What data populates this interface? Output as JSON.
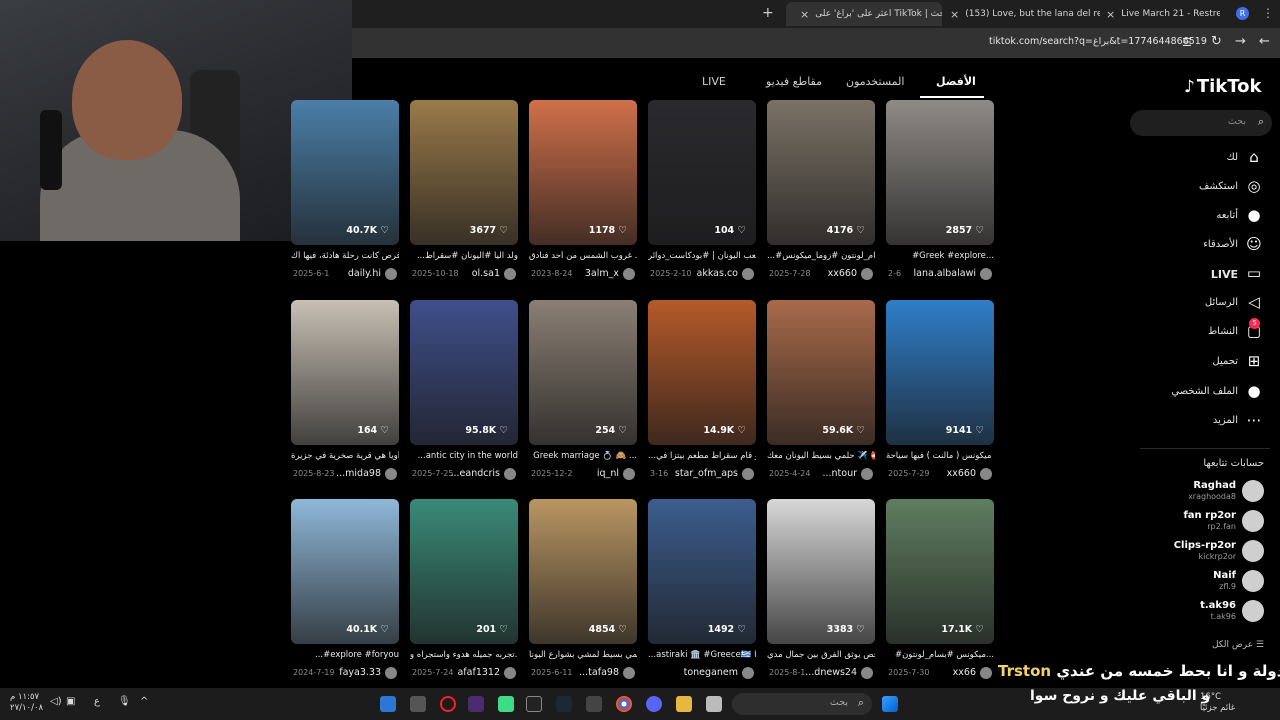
{
  "browser": {
    "tabs": [
      {
        "label": "Live March 21 - Restream"
      },
      {
        "label": "(153) Love, but the lana del rey"
      },
      {
        "label": "اعثر على 'براغ' على TikTok | بحث"
      }
    ],
    "url": "tiktok.com/search?q=براغ&t=1774644866519"
  },
  "header": {
    "categories": [
      "الأفضل",
      "المستخدمون",
      "مقاطع فيديو",
      "LIVE"
    ]
  },
  "sidebar": {
    "logo": "TikTok",
    "search_placeholder": "بحث",
    "nav": [
      {
        "label": "لك",
        "icon": "home-icon"
      },
      {
        "label": "استكشف",
        "icon": "compass-icon"
      },
      {
        "label": "أتابعه",
        "icon": "following-icon"
      },
      {
        "label": "الأصدقاء",
        "icon": "friends-icon"
      },
      {
        "label": "LIVE",
        "icon": "live-icon"
      },
      {
        "label": "الرسائل",
        "icon": "messages-icon"
      },
      {
        "label": "النشاط",
        "icon": "activity-icon",
        "badge": "5"
      },
      {
        "label": "تحميل",
        "icon": "upload-icon"
      },
      {
        "label": "الملف الشخصي",
        "icon": "profile-icon"
      },
      {
        "label": "المزيد",
        "icon": "more-icon"
      }
    ],
    "following_title": "حسابات تتابعها",
    "accounts": [
      {
        "name": "Raghad",
        "handle": "xraghooda8"
      },
      {
        "name": "fan rp2or",
        "handle": "rp2.fan"
      },
      {
        "name": "Clips-rp2or",
        "handle": "kickrp2or"
      },
      {
        "name": "Naif",
        "handle": "zfl.9"
      },
      {
        "name": "t.ak96",
        "handle": "t.ak96"
      }
    ],
    "see_all": "عرض الكل"
  },
  "videos": [
    {
      "likes": "2857",
      "caption": "#Greek #explore...",
      "date": "2-6",
      "user": "lana.albalawi",
      "color": "#8e8a86"
    },
    {
      "likes": "4176",
      "caption": "...#بسام_لونتون #زوما_ميكونس",
      "date": "2025-7-28",
      "user": "xx660",
      "color": "#7b7266"
    },
    {
      "likes": "104",
      "caption": "شعب اليونان | #بودكاست_دوائر",
      "date": "2025-2-10",
      "user": "akkas.co",
      "color": "#2a2a2e"
    },
    {
      "likes": "1178",
      "caption": "غروب الشمس من أحد فنادق ...",
      "date": "2023-8-24",
      "user": "3alm_x",
      "color": "#d0704a"
    },
    {
      "likes": "3677",
      "caption": "...ولد اليا #اليونان #سقراط",
      "date": "2025-10-18",
      "user": "ol.sa1",
      "color": "#9a7a4a"
    },
    {
      "likes": "40.7K",
      "caption": "فرص كانت رحلة هادئة، فيها أك...",
      "date": "2025-6-1",
      "user": "daily.hi",
      "color": "#4a7fa8"
    },
    {
      "likes": "9141",
      "caption": "ميكونس ( مالنت ) فيها سياحة ...",
      "date": "2025-7-29",
      "user": "xx660",
      "color": "#2f7ec9"
    },
    {
      "likes": "59.6K",
      "caption": "حلمي بسيط اليونان معك ✈️ 📛",
      "date": "2025-4-24",
      "user": "...ntour",
      "color": "#a86a4a"
    },
    {
      "likes": "14.9K",
      "caption": "...ماذا لو قام سقراط مطعم بيتزا في",
      "date": "3-16",
      "user": "star_ofm_aps",
      "color": "#b55a2a"
    },
    {
      "likes": "254",
      "caption": "Greek marriage 💍 🙈 ...",
      "date": "2025-12-2",
      "user": "iq_nl",
      "color": "#8b7f74"
    },
    {
      "likes": "95.8K",
      "caption": "...antic city in the world",
      "date": "2025-7-25",
      "user": "...eandcris",
      "color": "#3f4f8a"
    },
    {
      "likes": "164",
      "caption": "أويا هي قرية صخرية في جزيرة ...",
      "date": "2025-8-23",
      "user": "...mida98",
      "color": "#c8c0b4"
    },
    {
      "likes": "17.1K",
      "caption": "#ميكونس #بسام_لونتون...",
      "date": "2025-7-30",
      "user": "xx66",
      "color": "#5f7e60"
    },
    {
      "likes": "3383",
      "caption": "شخص يوثق الفرق بين جمال مدي...",
      "date": "2025-8-1",
      "user": "...dnews24",
      "color": "#d8d8d8"
    },
    {
      "likes": "1492",
      "caption": "...astiraki 🏛️ #Greece🇬🇷 اليا",
      "date": "",
      "user": "toneganem",
      "color": "#3c5d8e"
    },
    {
      "likes": "4854",
      "caption": "حلمي بسيط لمشي بشوارع اليونا...",
      "date": "2025-6-11",
      "user": "...tafa98",
      "color": "#b99663"
    },
    {
      "likes": "201",
      "caption": "تجربه جميله هدوء واستجراه و...",
      "date": "2025-7-24",
      "user": "afaf1312",
      "color": "#3a8a78"
    },
    {
      "likes": "40.1K",
      "caption": "...#explore #foryou",
      "date": "2024-7-19",
      "user": "faya3.33",
      "color": "#8fb8d8"
    }
  ],
  "overlay": {
    "line1_prefix": "Trston",
    "line1": "اختار دولة و انا بحط خمسه من عندي",
    "line2": "و الباقي عليك و نروح سوا"
  },
  "taskbar": {
    "search_placeholder": "بحث",
    "temperature": "16°C",
    "weather": "غائم جزئيًا",
    "time": "١١:٥٧ م",
    "date": "٢٧/١٠/٠٨"
  }
}
